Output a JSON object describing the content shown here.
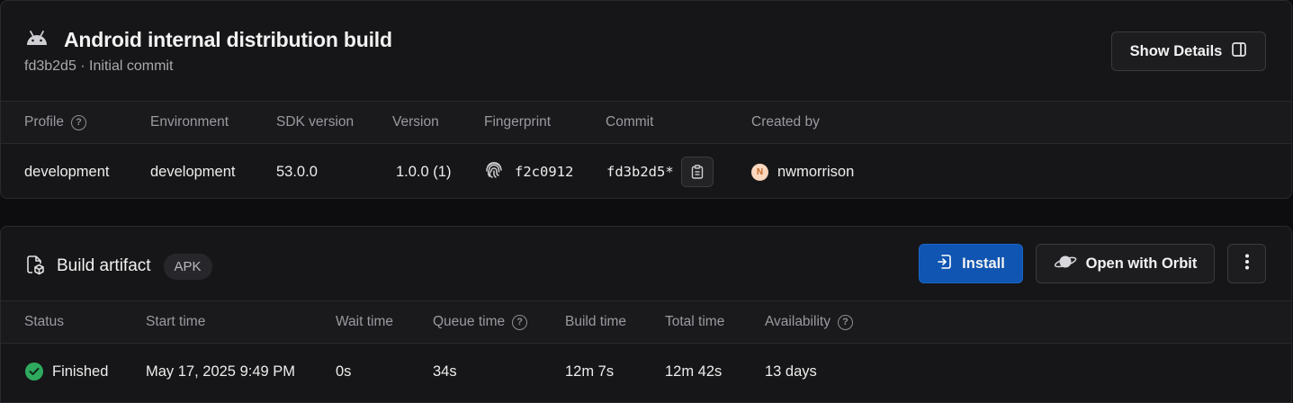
{
  "build": {
    "title": "Android internal distribution build",
    "subtitle": "fd3b2d5 · Initial commit",
    "show_details_label": "Show Details"
  },
  "details_table": {
    "headers": {
      "profile": "Profile",
      "environment": "Environment",
      "sdk_version": "SDK version",
      "version": "Version",
      "fingerprint": "Fingerprint",
      "commit": "Commit",
      "created_by": "Created by"
    },
    "values": {
      "profile": "development",
      "environment": "development",
      "sdk_version": "53.0.0",
      "version": "1.0.0 (1)",
      "fingerprint": "f2c0912",
      "commit": "fd3b2d5*",
      "created_by": "nwmorrison",
      "avatar_initial": "N"
    }
  },
  "artifact": {
    "title": "Build artifact",
    "badge": "APK",
    "install_label": "Install",
    "orbit_label": "Open with Orbit"
  },
  "status_table": {
    "headers": {
      "status": "Status",
      "start_time": "Start time",
      "wait_time": "Wait time",
      "queue_time": "Queue time",
      "build_time": "Build time",
      "total_time": "Total time",
      "availability": "Availability"
    },
    "values": {
      "status": "Finished",
      "start_time": "May 17, 2025 9:49 PM",
      "wait_time": "0s",
      "queue_time": "34s",
      "build_time": "12m 7s",
      "total_time": "12m 42s",
      "availability": "13 days"
    }
  },
  "icons": {
    "platform": "android-icon",
    "panel": "sidebar-panel-icon",
    "fingerprint": "fingerprint-icon",
    "copy": "clipboard-icon",
    "artifact": "package-file-icon",
    "install": "install-icon",
    "orbit": "planet-icon",
    "more": "more-vertical-icon",
    "status": "check-circle-icon"
  },
  "colors": {
    "primary": "#0f55b1",
    "success": "#2eaa5e",
    "background": "#161618"
  }
}
